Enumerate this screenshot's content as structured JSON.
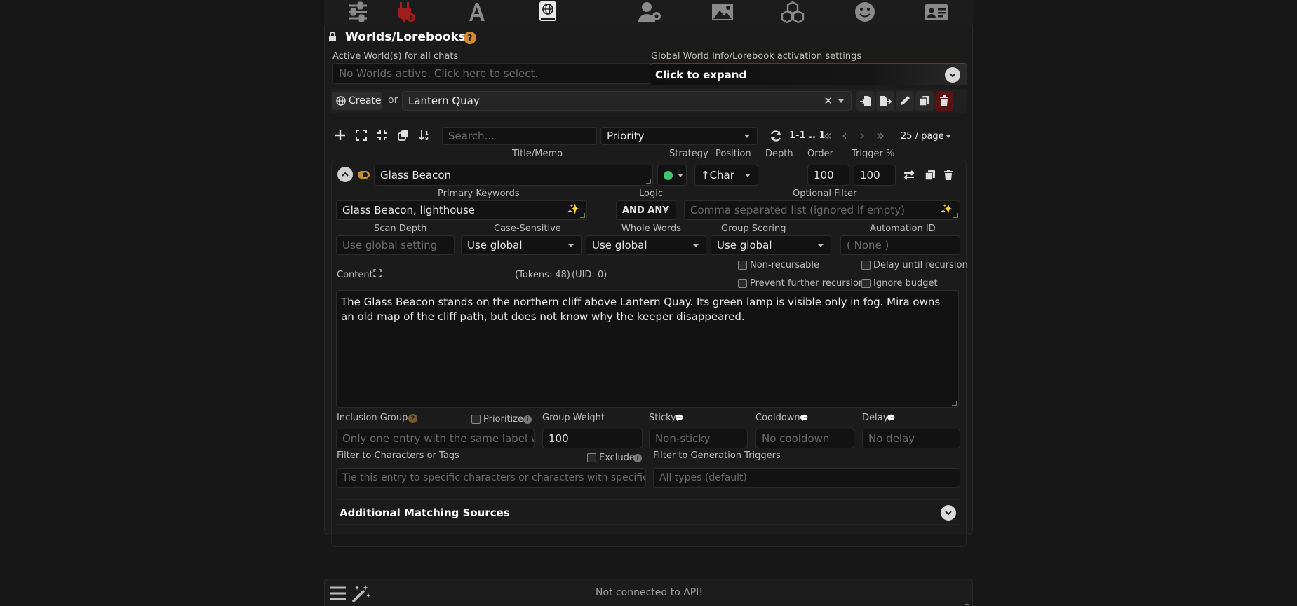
{
  "nav_icons": [
    "sliders-icon",
    "plug-icon",
    "font-icon",
    "book-globe-icon",
    "user-gear-icon",
    "image-icon",
    "cubes-icon",
    "smiley-icon",
    "id-card-icon"
  ],
  "panel": {
    "title": "Worlds/Lorebooks",
    "active_worlds_label": "Active World(s) for all chats",
    "active_worlds_placeholder": "No Worlds active. Click here to select.",
    "global_settings_label": "Global World Info/Lorebook activation settings",
    "global_settings_expand": "Click to expand"
  },
  "book_bar": {
    "create_label": "Create",
    "or_text": "or",
    "selected_book": "Lantern Quay"
  },
  "entries_toolbar": {
    "search_placeholder": "Search...",
    "sort_value": "Priority",
    "page_range": "1-1 .. 1",
    "page_size": "25 / page"
  },
  "headers": {
    "title_memo": "Title/Memo",
    "strategy": "Strategy",
    "position": "Position",
    "depth": "Depth",
    "order": "Order",
    "trigger": "Trigger %"
  },
  "entry": {
    "title": "Glass Beacon",
    "position_value": "↑Char",
    "order": "100",
    "trigger": "100",
    "primary_keywords_label": "Primary Keywords",
    "primary_keywords_value": "Glass Beacon, lighthouse",
    "logic_label": "Logic",
    "logic_value": "AND ANY",
    "optional_filter_label": "Optional Filter",
    "optional_filter_placeholder": "Comma separated list (ignored if empty)",
    "scan_depth_label": "Scan Depth",
    "scan_depth_placeholder": "Use global setting",
    "case_sensitive_label": "Case-Sensitive",
    "case_sensitive_value": "Use global",
    "whole_words_label": "Whole Words",
    "whole_words_value": "Use global",
    "group_scoring_label": "Group Scoring",
    "group_scoring_value": "Use global",
    "automation_id_label": "Automation ID",
    "automation_id_placeholder": "( None )",
    "content_label": "Content",
    "tokens_text": "(Tokens:  48)",
    "uid_text": "(UID: 0)",
    "non_recursable": "Non-recursable",
    "delay_until_recursion": "Delay until recursion",
    "prevent_further_recursion": "Prevent further recursion",
    "ignore_budget": "Ignore budget",
    "content_text": "The Glass Beacon stands on the northern cliff above Lantern Quay. Its green lamp is visible only in fog. Mira owns an old map of the cliff path, but does not know why the keeper disappeared.",
    "inclusion_group_label": "Inclusion Group",
    "inclusion_group_placeholder": "Only one entry with the same label will",
    "prioritize_label": "Prioritize",
    "group_weight_label": "Group Weight",
    "group_weight_value": "100",
    "sticky_label": "Sticky",
    "sticky_placeholder": "Non-sticky",
    "cooldown_label": "Cooldown",
    "cooldown_placeholder": "No cooldown",
    "delay_label": "Delay",
    "delay_placeholder": "No delay",
    "filter_chars_label": "Filter to Characters or Tags",
    "exclude_label": "Exclude",
    "filter_chars_placeholder": "Tie this entry to specific characters or characters with specific",
    "filter_triggers_label": "Filter to Generation Triggers",
    "filter_triggers_placeholder": "All types (default)",
    "additional_sources": "Additional Matching Sources"
  },
  "bottom": {
    "status": "Not connected to API!"
  },
  "colors": {
    "accent_orange": "#d08b2d",
    "status_green": "#3ec46d",
    "delete_red": "#a11e1e"
  }
}
